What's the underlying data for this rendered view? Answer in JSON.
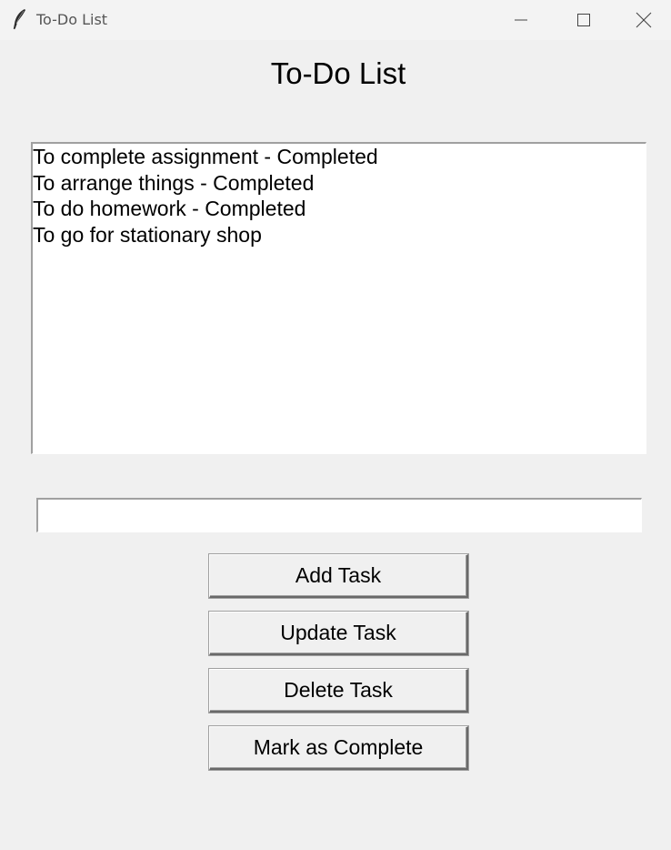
{
  "window": {
    "title": "To-Do List",
    "icon": "feather-icon",
    "controls": {
      "minimize": "minimize-icon",
      "maximize": "maximize-icon",
      "close": "close-icon"
    }
  },
  "heading": "To-Do List",
  "tasks": [
    "To complete assignment - Completed",
    "To arrange things - Completed",
    "To do homework - Completed",
    "To go for stationary shop"
  ],
  "task_input": {
    "value": "",
    "placeholder": ""
  },
  "buttons": {
    "add": "Add Task",
    "update": "Update Task",
    "delete": "Delete Task",
    "complete": "Mark as Complete"
  }
}
